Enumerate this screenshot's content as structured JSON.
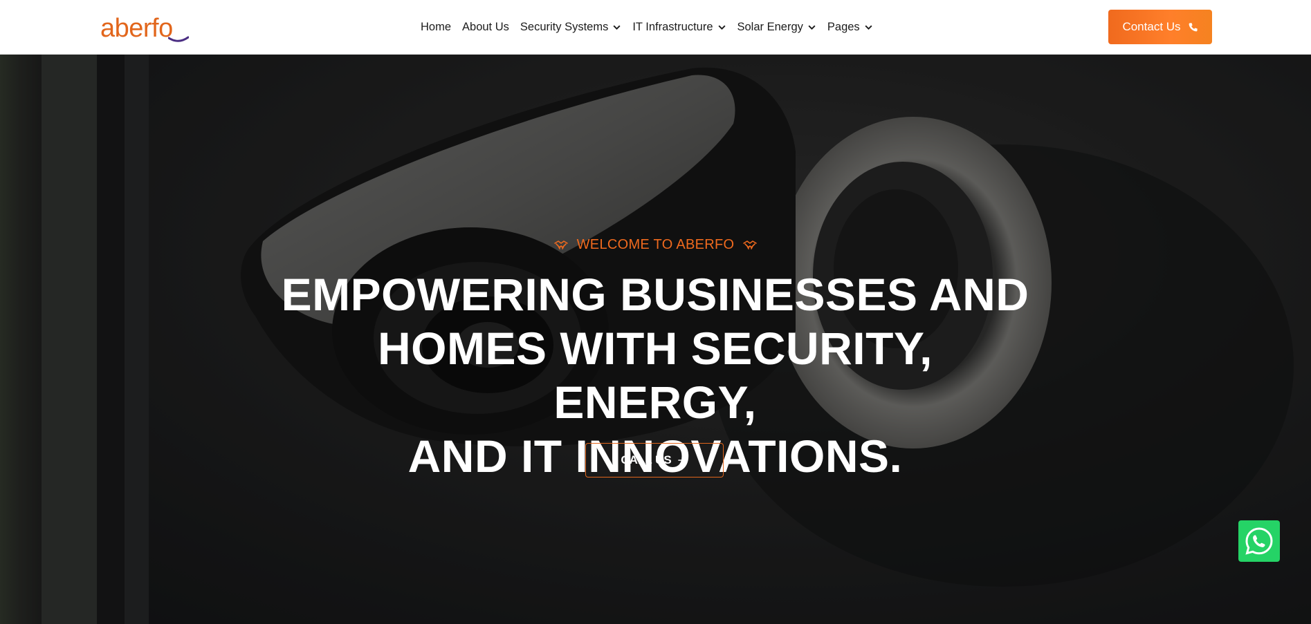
{
  "header": {
    "logo_text": "aberfo",
    "nav": [
      {
        "label": "Home",
        "has_dropdown": false
      },
      {
        "label": "About Us",
        "has_dropdown": false
      },
      {
        "label": "Security Systems",
        "has_dropdown": true
      },
      {
        "label": "IT Infrastructure",
        "has_dropdown": true
      },
      {
        "label": "Solar Energy",
        "has_dropdown": true
      },
      {
        "label": "Pages",
        "has_dropdown": true
      }
    ],
    "contact_label": "Contact Us",
    "contact_icon": "phone-icon"
  },
  "hero": {
    "welcome": "WELCOME TO ABERFO",
    "headline_line1": "EMPOWERING BUSINESSES AND",
    "headline_line2": "HOMES WITH SECURITY, ENERGY,",
    "headline_line3": "AND IT INNOVATIONS.",
    "cta_label": "CALL US",
    "cta_icon": "arrow-right-icon",
    "background_subject": "security-camera"
  },
  "floating": {
    "whatsapp_icon": "whatsapp-icon"
  },
  "colors": {
    "accent": "#f06a1e",
    "whatsapp": "#25d366",
    "text_light": "#ffffff",
    "text_dark": "#1c1c1c"
  }
}
